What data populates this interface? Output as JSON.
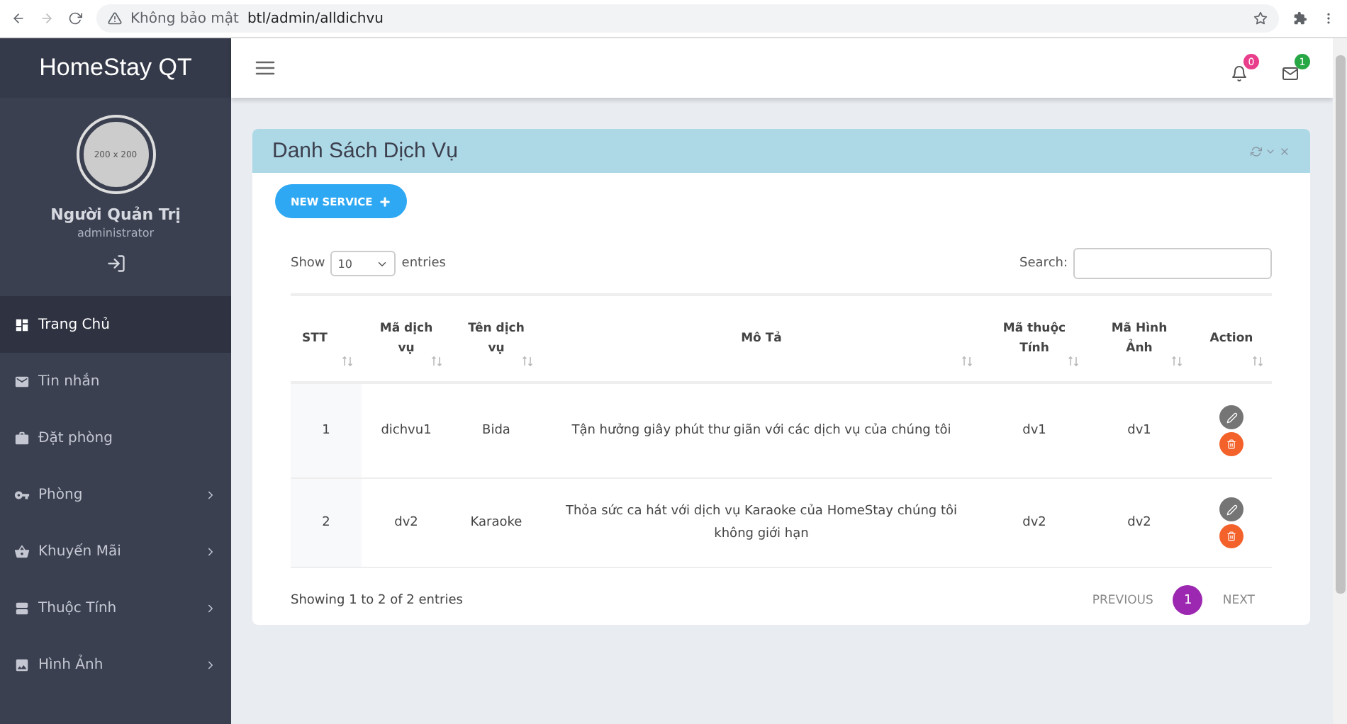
{
  "browser": {
    "security": "Không bảo mật",
    "url": "btl/admin/alldichvu"
  },
  "sidebar": {
    "brand": "HomeStay QT",
    "avatar_text": "200 x 200",
    "user_name": "Người Quản Trị",
    "user_role": "administrator",
    "items": [
      {
        "label": "Trang Chủ",
        "selected": true,
        "has_submenu": false
      },
      {
        "label": "Tin nhắn",
        "selected": false,
        "has_submenu": false
      },
      {
        "label": "Đặt phòng",
        "selected": false,
        "has_submenu": false
      },
      {
        "label": "Phòng",
        "selected": false,
        "has_submenu": true
      },
      {
        "label": "Khuyến Mãi",
        "selected": false,
        "has_submenu": true
      },
      {
        "label": "Thuộc Tính",
        "selected": false,
        "has_submenu": true
      },
      {
        "label": "Hình Ảnh",
        "selected": false,
        "has_submenu": true
      }
    ]
  },
  "header": {
    "notifications": "0",
    "messages": "1"
  },
  "card": {
    "title": "Danh Sách Dịch Vụ",
    "new_button": "NEW SERVICE",
    "show_label": "Show",
    "page_size": "10",
    "entries_label": "entries",
    "search_label": "Search:",
    "columns": [
      "STT",
      "Mã dịch vụ",
      "Tên dịch vụ",
      "Mô Tả",
      "Mã thuộc Tính",
      "Mã Hình Ảnh",
      "Action"
    ],
    "rows": [
      [
        "1",
        "dichvu1",
        "Bida",
        "Tận hưởng giây phút thư giãn với các dịch vụ của chúng tôi",
        "dv1",
        "dv1"
      ],
      [
        "2",
        "dv2",
        "Karaoke",
        "Thỏa sức ca hát với dịch vụ Karaoke của HomeStay chúng tôi không giới hạn",
        "dv2",
        "dv2"
      ]
    ],
    "info": "Showing 1 to 2 of 2 entries",
    "previous": "PREVIOUS",
    "pages": [
      {
        "label": "1",
        "selected": true
      }
    ],
    "next": "NEXT"
  }
}
